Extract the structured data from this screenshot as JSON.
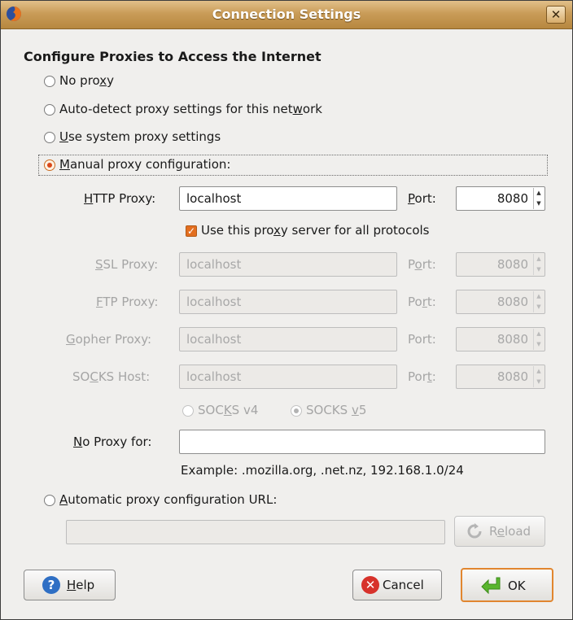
{
  "window": {
    "title": "Connection Settings",
    "close_glyph": "✕"
  },
  "heading": "Configure Proxies to Access the Internet",
  "options": {
    "no_proxy": {
      "pre": "No pro",
      "u": "x",
      "post": "y"
    },
    "auto_detect": {
      "pre": "Auto-detect proxy settings for this net",
      "u": "w",
      "post": "ork"
    },
    "system": {
      "pre": "",
      "u": "U",
      "post": "se system proxy settings"
    },
    "manual": {
      "pre": "",
      "u": "M",
      "post": "anual proxy configuration:"
    },
    "auto_url": {
      "pre": "",
      "u": "A",
      "post": "utomatic proxy configuration URL:"
    }
  },
  "http": {
    "label_u": "H",
    "label_post": "TTP Proxy:",
    "value": "localhost",
    "port_label_u": "P",
    "port_label_post": "ort:",
    "port": "8080"
  },
  "use_all": {
    "pre": "Use this pro",
    "u": "x",
    "post": "y server for all protocols"
  },
  "ssl": {
    "label_u": "S",
    "label_post": "SL Proxy:",
    "value": "localhost",
    "port_pre": "P",
    "port_u": "o",
    "port_post": "rt:",
    "port": "8080"
  },
  "ftp": {
    "label_u": "F",
    "label_post": "TP Proxy:",
    "value": "localhost",
    "port_pre": "Po",
    "port_u": "r",
    "port_post": "t:",
    "port": "8080"
  },
  "gopher": {
    "label_u": "G",
    "label_post": "opher Proxy:",
    "value": "localhost",
    "port_label": "Port:",
    "port": "8080"
  },
  "socks": {
    "label_pre": "SO",
    "label_u": "C",
    "label_post": "KS Host:",
    "value": "localhost",
    "port_pre": "Por",
    "port_u": "t",
    "port_post": ":",
    "port": "8080",
    "v4_pre": "SOC",
    "v4_u": "K",
    "v4_post": "S v4",
    "v5_pre": "SOCKS ",
    "v5_u": "v",
    "v5_post": "5"
  },
  "no_proxy_for": {
    "label_u": "N",
    "label_post": "o Proxy for:",
    "value": "",
    "example": "Example: .mozilla.org, .net.nz, 192.168.1.0/24"
  },
  "auto_url_value": "",
  "buttons": {
    "reload": {
      "pre": "R",
      "u": "e",
      "post": "load"
    },
    "help": {
      "u": "H",
      "post": "elp"
    },
    "cancel": "Cancel",
    "ok": "OK"
  },
  "colors": {
    "titlebar": "#c99c58",
    "accent": "#e36e1f",
    "help": "#2f6fc4",
    "cancel": "#d7322b",
    "ok": "#59b52e"
  }
}
